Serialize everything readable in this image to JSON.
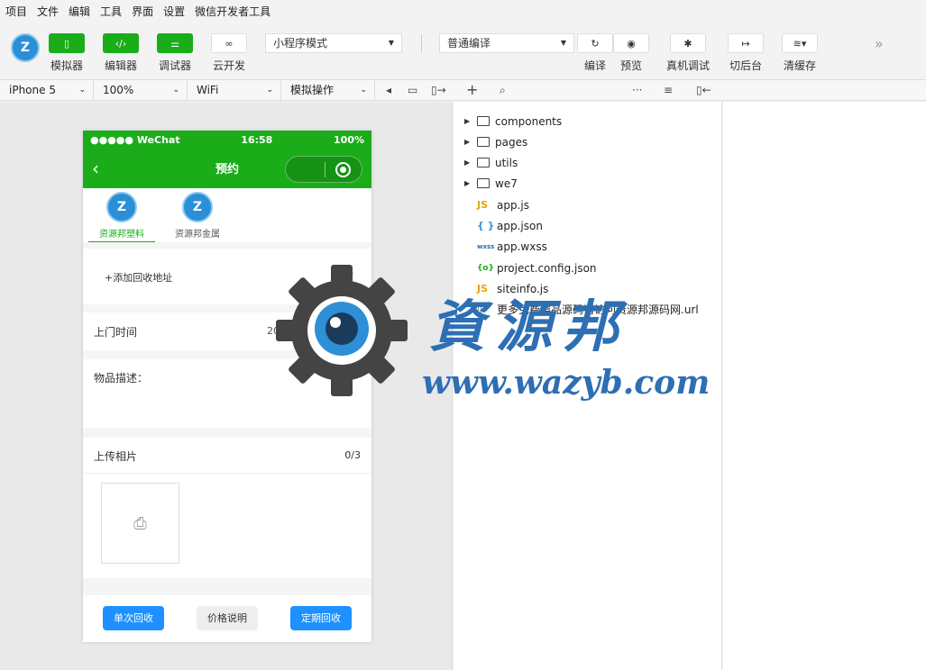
{
  "menu": [
    "项目",
    "文件",
    "编辑",
    "工具",
    "界面",
    "设置",
    "微信开发者工具"
  ],
  "toolbar": {
    "simulator": "模拟器",
    "editor": "编辑器",
    "debugger": "调试器",
    "cloud": "云开发",
    "mode_select": "小程序模式",
    "compile_select": "普通编译",
    "compile": "编译",
    "preview": "预览",
    "remote_debug": "真机调试",
    "background": "切后台",
    "clear_cache": "清缓存"
  },
  "subbar": {
    "device": "iPhone 5",
    "zoom": "100%",
    "network": "WiFi",
    "operation": "模拟操作"
  },
  "phone": {
    "status": {
      "carrier": "●●●●● WeChat",
      "time": "16:58",
      "battery": "100%"
    },
    "nav_title": "预约",
    "tabs": [
      {
        "label": "资源邦塑料",
        "logo": "Z"
      },
      {
        "label": "资源邦金属",
        "logo": "Z"
      }
    ],
    "add_address": "+添加回收地址",
    "visit_time_label": "上门时间",
    "visit_time_value": "2019-08-2",
    "item_desc_label": "物品描述：",
    "upload_label": "上传相片",
    "upload_count": "0/3",
    "buttons": {
      "single": "单次回收",
      "price": "价格说明",
      "regular": "定期回收"
    }
  },
  "files": [
    {
      "name": "components",
      "type": "folder"
    },
    {
      "name": "pages",
      "type": "folder"
    },
    {
      "name": "utils",
      "type": "folder"
    },
    {
      "name": "we7",
      "type": "folder"
    },
    {
      "name": "app.js",
      "type": "js",
      "icon": "JS"
    },
    {
      "name": "app.json",
      "type": "json",
      "icon": "{ }"
    },
    {
      "name": "app.wxss",
      "type": "wxss",
      "icon": "wxss"
    },
    {
      "name": "project.config.json",
      "type": "config",
      "icon": "{o}"
    },
    {
      "name": "siteinfo.js",
      "type": "js",
      "icon": "JS"
    },
    {
      "name": "更多免费精品源码请访问资源邦源码网.url",
      "type": "url",
      "icon": "▯"
    }
  ],
  "watermark": {
    "title": "資源邦",
    "url": "www.wazyb.com"
  },
  "colors": {
    "brand_green": "#1aad19",
    "button_blue": "#1e90ff",
    "watermark_blue": "#2e6fb4",
    "js_yellow": "#e5a800"
  }
}
